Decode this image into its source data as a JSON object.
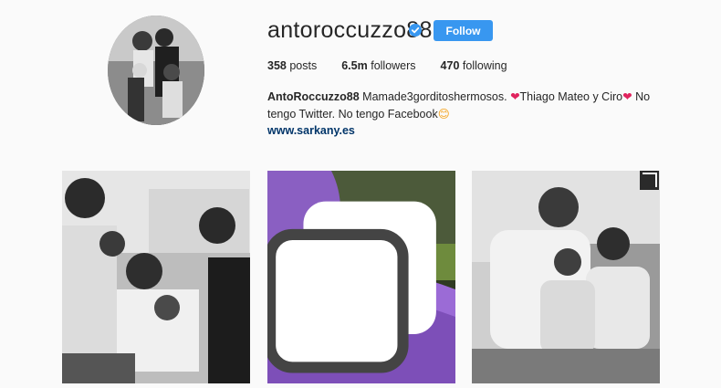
{
  "profile": {
    "username": "antoroccuzzo88",
    "verified": true,
    "follow_label": "Follow",
    "stats": {
      "posts_count": "358",
      "posts_label": "posts",
      "followers_count": "6.5m",
      "followers_label": "followers",
      "following_count": "470",
      "following_label": "following"
    },
    "bio": {
      "name": "AntoRoccuzzo88",
      "text1": " Mamade3gorditoshermosos. ",
      "heart1": "❤",
      "text2": "Thiago Mateo y Ciro",
      "heart2": "❤",
      "text3": " No tengo Twitter. No tengo Facebook",
      "emoji": "😊"
    },
    "website": "www.sarkany.es"
  },
  "colors": {
    "follow_button": "#3897f0",
    "link": "#003569",
    "verified": "#3897f0",
    "heart": "#e0245e"
  },
  "posts": [
    {
      "icon": "none"
    },
    {
      "icon": "multiple-photos-icon"
    },
    {
      "icon": "none"
    }
  ]
}
